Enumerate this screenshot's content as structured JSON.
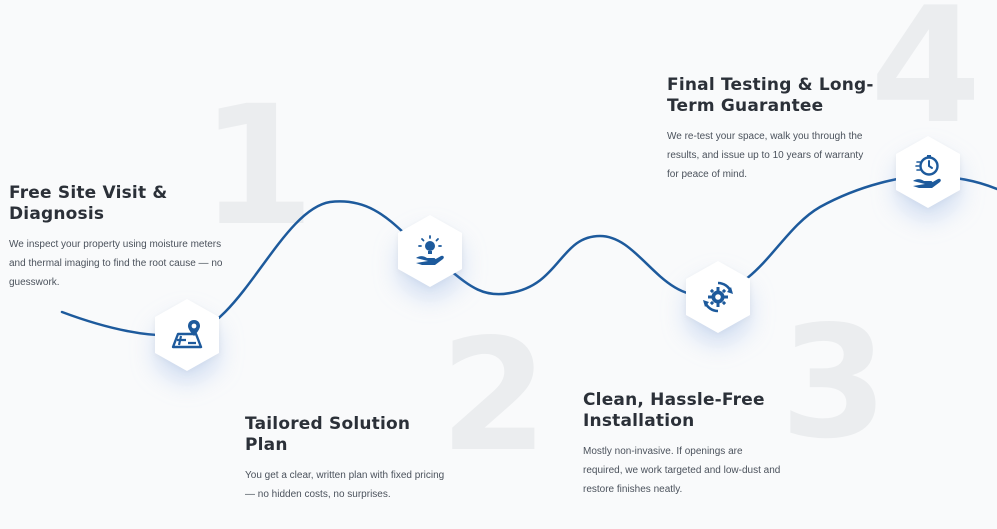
{
  "steps": [
    {
      "number": "1",
      "title": "Free Site Visit & Diagnosis",
      "description": "We inspect your property using moisture meters and thermal imaging to find the root cause — no guesswork.",
      "icon": "map-location-icon"
    },
    {
      "number": "2",
      "title": "Tailored Solution Plan",
      "description": "You get a clear, written plan with fixed pricing — no hidden costs, no surprises.",
      "icon": "idea-hand-icon"
    },
    {
      "number": "3",
      "title": "Clean, Hassle-Free Installation",
      "description": "Mostly non-invasive. If openings are required, we work targeted and low-dust and restore finishes neatly.",
      "icon": "gear-cycle-icon"
    },
    {
      "number": "4",
      "title": "Final Testing & Long-Term Guarantee",
      "description": "We re-test your space, walk you through the results, and issue up to 10 years of warranty for peace of mind.",
      "icon": "clock-hand-icon"
    }
  ],
  "colors": {
    "accent": "#1d5a9c",
    "big_number": "#ebedef",
    "background": "#f9fafb"
  }
}
